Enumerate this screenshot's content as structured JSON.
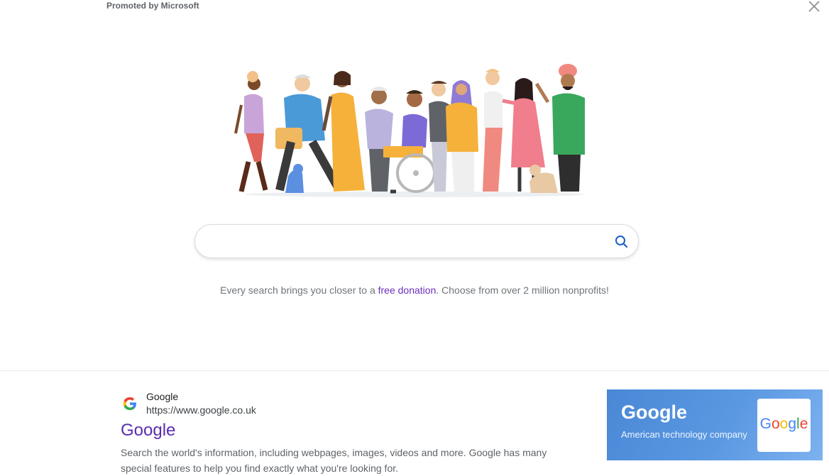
{
  "promo": {
    "label": "Promoted by Microsoft"
  },
  "search": {
    "placeholder": "",
    "value": ""
  },
  "tagline": {
    "prefix": "Every search brings you closer to a ",
    "link": "free donation",
    "suffix": ". Choose from over 2 million nonprofits!"
  },
  "result": {
    "site_name": "Google",
    "url": "https://www.google.co.uk",
    "title": "Google",
    "description": "Search the world's information, including webpages, images, videos and more. Google has many special features to help you find exactly what you're looking for."
  },
  "kg_card": {
    "title": "Google",
    "subtitle": "American technology company",
    "logo_letters": [
      "G",
      "o",
      "o",
      "g",
      "l",
      "e"
    ]
  },
  "icons": {
    "close": "close-icon",
    "search": "search-icon",
    "google": "google-g-icon"
  },
  "colors": {
    "link_purple": "#6b2fbf",
    "title_purple": "#5a2db0",
    "card_blue": "#4a88d6",
    "google_blue": "#4285f4",
    "google_red": "#ea4335",
    "google_yellow": "#fbbc05",
    "google_green": "#34a853"
  }
}
